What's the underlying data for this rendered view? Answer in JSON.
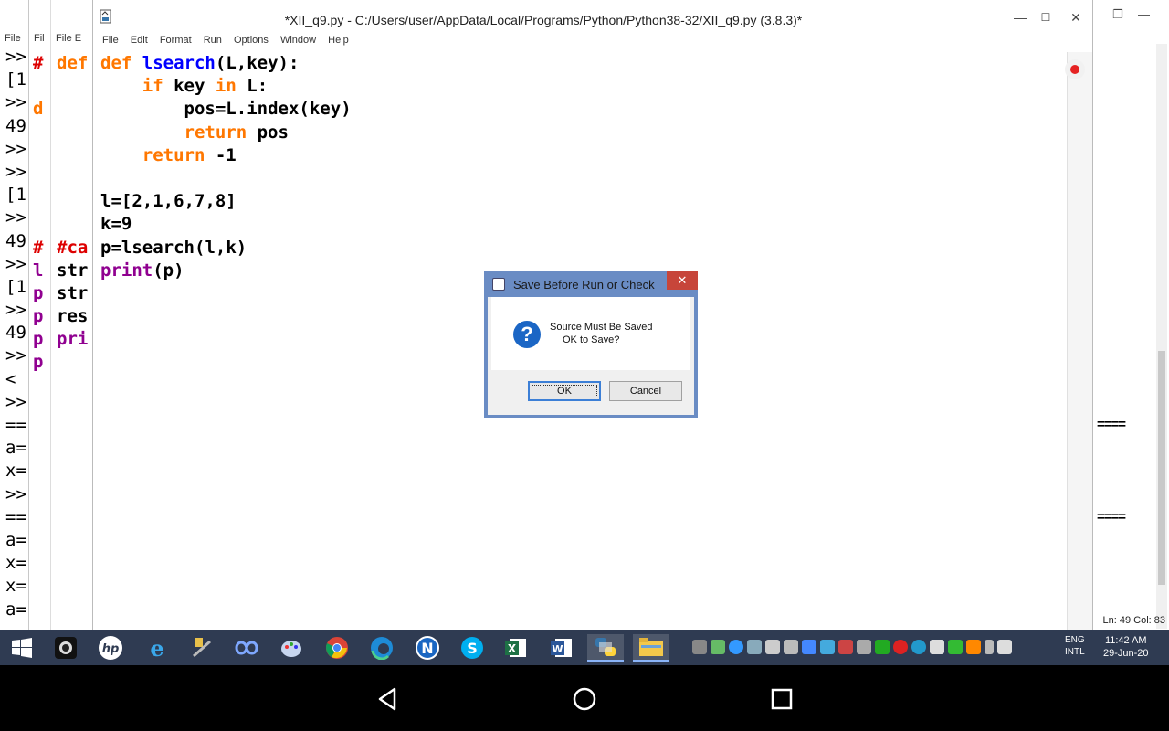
{
  "editor": {
    "title": "*XII_q9.py - C:/Users/user/AppData/Local/Programs/Python/Python38-32/XII_q9.py (3.8.3)*",
    "menu": [
      "File",
      "Edit",
      "Format",
      "Run",
      "Options",
      "Window",
      "Help"
    ],
    "controls": {
      "minimize": "—",
      "maximize": "☐",
      "close": "✕"
    }
  },
  "code_lines": [
    "def lsearch(L,key):",
    "    if key in L:",
    "        pos=L.index(key)",
    "        return pos",
    "    return -1",
    "",
    "l=[2,1,6,7,8]",
    "k=9",
    "p=lsearch(l,k)",
    "print(p)"
  ],
  "background_windows": {
    "shell_menu": "File",
    "editor2_menu": "Fil",
    "editor3_menu": "File  E",
    "shell_lines": [
      ">>",
      "[1",
      ">>",
      "49",
      ">>",
      ">>",
      "[1",
      ">>",
      "49",
      ">>",
      "[1",
      ">>",
      "49",
      ">>",
      "<",
      ">>",
      "==",
      "a=",
      "x=",
      ">>",
      "==",
      "a=",
      "x=",
      "x=",
      "a="
    ],
    "editor2_lines": [
      "#",
      "",
      "d",
      "",
      "",
      "",
      "",
      "",
      "#",
      "l",
      "p",
      "p",
      "p",
      "p"
    ],
    "editor3_lines": [
      "def",
      "",
      "",
      "",
      "",
      "",
      "",
      "",
      "#ca",
      "str",
      "str",
      "res",
      "pri",
      ""
    ],
    "right_shell_rule": "====",
    "right_shell_status": "Ln: 49   Col: 83"
  },
  "dialog": {
    "title": "Save Before Run or Check",
    "message_line1": "Source Must Be Saved",
    "message_line2": "OK to Save?",
    "ok_label": "OK",
    "cancel_label": "Cancel",
    "close_label": "✕"
  },
  "taskbar": {
    "apps": [
      "start",
      "camera",
      "hp",
      "internet-explorer",
      "tools",
      "infinity",
      "paint",
      "chrome",
      "edge",
      "norton",
      "skype",
      "excel",
      "word",
      "python",
      "explorer"
    ],
    "language": "ENG",
    "language_sub": "INTL",
    "time": "11:42 AM",
    "date": "29-Jun-20"
  }
}
